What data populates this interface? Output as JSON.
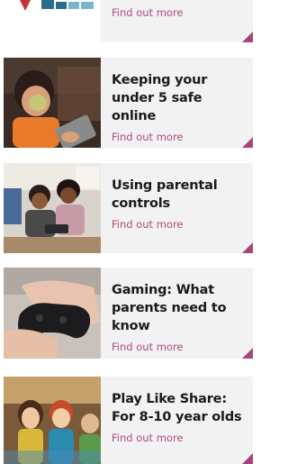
{
  "cards": [
    {
      "title": "",
      "link": "Find out more",
      "image": "logo-partial-image"
    },
    {
      "title": "Keeping your under 5 safe online",
      "link": "Find out more",
      "image": "toddler-tablet-photo"
    },
    {
      "title": "Using parental controls",
      "link": "Find out more",
      "image": "children-tablet-photo"
    },
    {
      "title": "Gaming: What parents need to know",
      "link": "Find out more",
      "image": "game-controller-photo"
    },
    {
      "title": "Play Like Share: For 8-10 year olds",
      "link": "Find out more",
      "image": "cartoon-characters-image"
    }
  ],
  "colors": {
    "accent": "#a8437a",
    "link": "#b04a80",
    "card_bg": "#f2f2f2",
    "title": "#1a1a1a"
  }
}
